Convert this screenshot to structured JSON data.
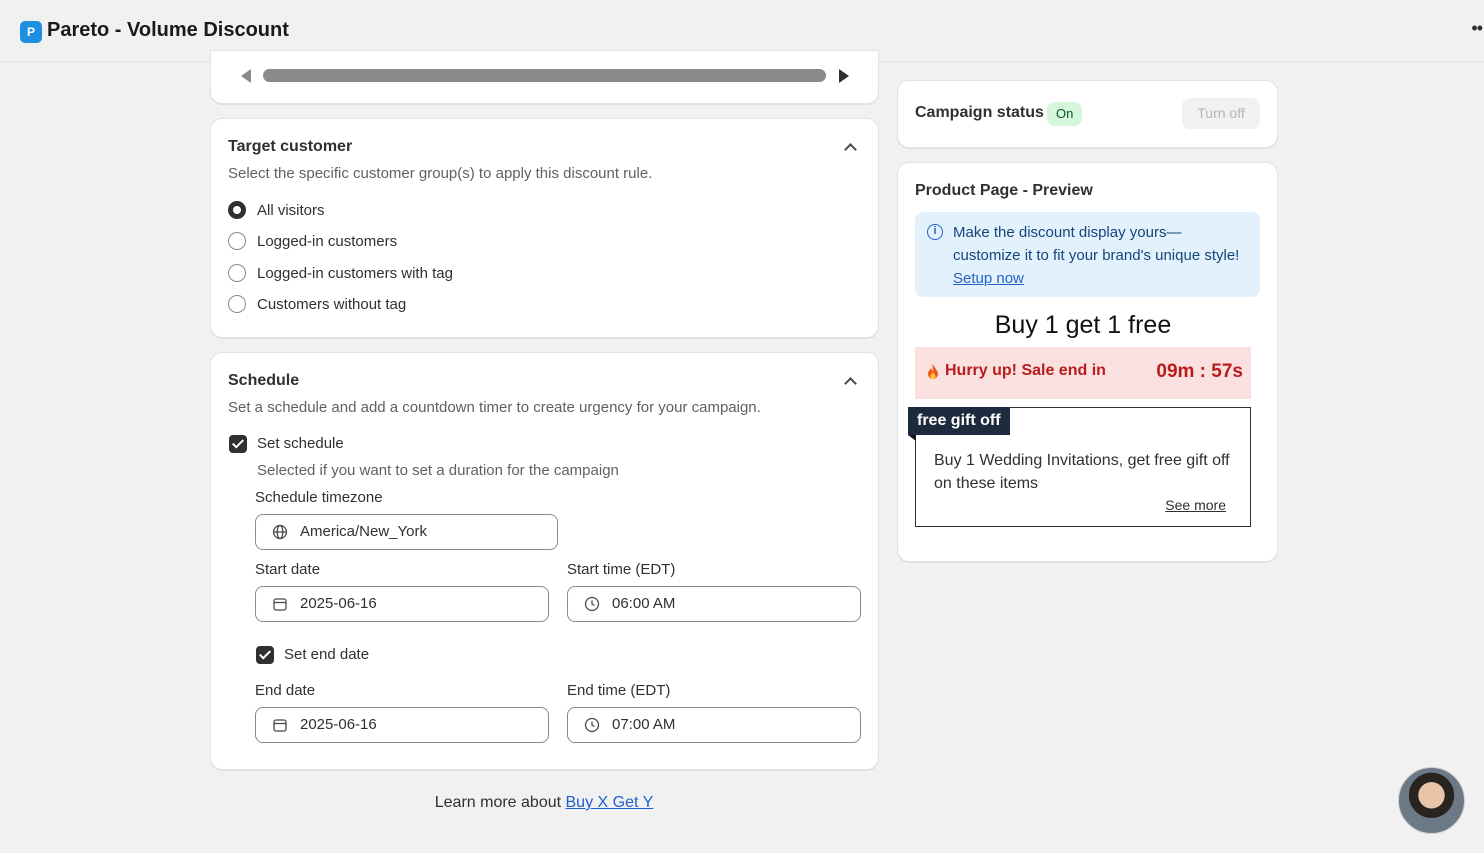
{
  "app": {
    "icon_text": "P",
    "title": "Pareto - Volume Discount"
  },
  "target_customer": {
    "title": "Target customer",
    "description": "Select the specific customer group(s) to apply this discount rule.",
    "options": [
      "All visitors",
      "Logged-in customers",
      "Logged-in customers with tag",
      "Customers without tag"
    ],
    "selected": "All visitors"
  },
  "schedule": {
    "title": "Schedule",
    "description": "Set a schedule and add a countdown timer to create urgency for your campaign.",
    "set_schedule_label": "Set schedule",
    "set_schedule_help": "Selected if you want to set a duration for the campaign",
    "timezone_label": "Schedule timezone",
    "timezone_value": "America/New_York",
    "start_date_label": "Start date",
    "start_date_value": "2025-06-16",
    "start_time_label": "Start time (EDT)",
    "start_time_value": "06:00 AM",
    "set_end_date_label": "Set end date",
    "end_date_label": "End date",
    "end_date_value": "2025-06-16",
    "end_time_label": "End time (EDT)",
    "end_time_value": "07:00 AM"
  },
  "learn_more": {
    "prefix": "Learn more about ",
    "link": "Buy X Get Y"
  },
  "campaign_status": {
    "title": "Campaign status",
    "badge": "On",
    "button": "Turn off"
  },
  "preview": {
    "title": "Product Page - Preview",
    "banner_text": "Make the discount display yours—customize it to fit your brand's unique style! ",
    "banner_link": "Setup now",
    "offer_title": "Buy 1 get 1 free",
    "hurry_text": "Hurry up! Sale end in",
    "countdown": "09m : 57s",
    "gift_tag": "free gift off",
    "gift_desc": "Buy 1 Wedding Invitations, get free gift off on these items",
    "see_more": "See more"
  },
  "colors": {
    "accent_dark": "#303030",
    "badge_green": "#d4f7dc",
    "banner_blue": "#e3f1fd",
    "hurry_red": "#b91c1c",
    "link_blue": "#1f5fd1"
  }
}
